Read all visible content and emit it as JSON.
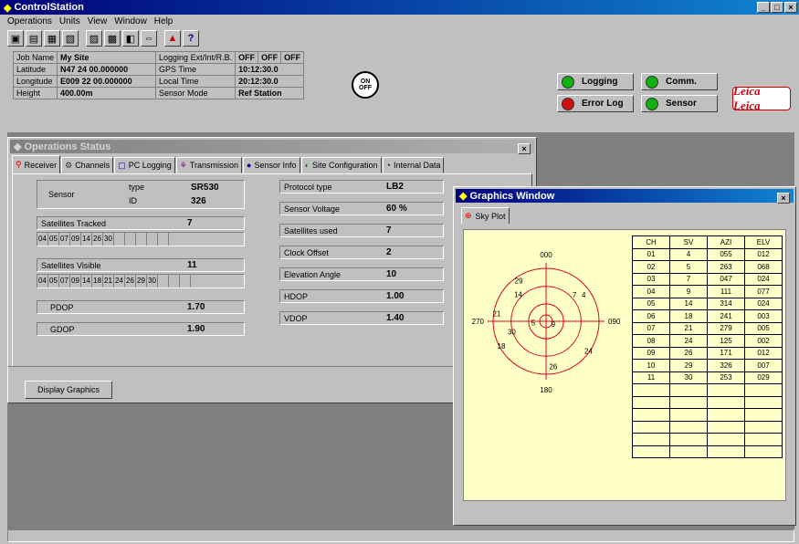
{
  "app_title": "ControlStation",
  "menu": [
    "Operations",
    "Units",
    "View",
    "Window",
    "Help"
  ],
  "toolbar_icons": [
    "tool1-icon",
    "tool2-icon",
    "tool3-icon",
    "tool4-icon",
    "tool5-icon",
    "tool6-icon",
    "tool7-icon",
    "tool8-icon",
    "tool9-icon",
    "help-icon"
  ],
  "info": {
    "job_name_label": "Job Name",
    "job_name": "My Site",
    "latitude_label": "Latitude",
    "latitude": "N47 24 00.000000",
    "longitude_label": "Longitude",
    "longitude": "E009 22 00.000000",
    "height_label": "Height",
    "height": "400.00m",
    "logging_label": "Logging Ext/Int/R.B.",
    "logging_vals": [
      "OFF",
      "OFF",
      "OFF"
    ],
    "gps_time_label": "GPS Time",
    "gps_time": "10:12:30.0",
    "local_time_label": "Local Time",
    "local_time": "20:12:30.0",
    "sensor_mode_label": "Sensor Mode",
    "sensor_mode": "Ref Station",
    "onoff": "ON OFF"
  },
  "status_buttons": [
    {
      "label": "Logging",
      "color": "#10b010"
    },
    {
      "label": "Comm.",
      "color": "#10b010"
    },
    {
      "label": "Error Log",
      "color": "#d01010"
    },
    {
      "label": "Sensor",
      "color": "#10b010"
    }
  ],
  "logo": "Leica Leica",
  "ops": {
    "title": "Operations Status",
    "tabs": [
      "Receiver",
      "Channels",
      "PC Logging",
      "Transmission",
      "Sensor Info",
      "Site Configuration",
      "Internal Data"
    ],
    "sensor_label": "Sensor",
    "type_label": "type",
    "type_val": "SR530",
    "id_label": "ID",
    "id_val": "326",
    "tracked_label": "Satellites Tracked",
    "tracked_count": "7",
    "tracked_list": [
      "04",
      "05",
      "07",
      "09",
      "14",
      "26",
      "30",
      "",
      "",
      "",
      "",
      ""
    ],
    "visible_label": "Satellites Visible",
    "visible_count": "11",
    "visible_list": [
      "04",
      "05",
      "07",
      "09",
      "14",
      "18",
      "21",
      "24",
      "26",
      "29",
      "30",
      "",
      "",
      ""
    ],
    "pdop_label": "PDOP",
    "pdop": "1.70",
    "gdop_label": "GDOP",
    "gdop": "1.90",
    "protocol_label": "Protocol type",
    "protocol": "LB2",
    "voltage_label": "Sensor Voltage",
    "voltage": "60 %",
    "sat_used_label": "Satellites used",
    "sat_used": "7",
    "clock_label": "Clock Offset",
    "clock": "2",
    "elev_label": "Elevation Angle",
    "elev": "10",
    "hdop_label": "HDOP",
    "hdop": "1.00",
    "vdop_label": "VDOP",
    "vdop": "1.40",
    "display_btn": "Display Graphics"
  },
  "graphics": {
    "title": "Graphics Window",
    "tab": "Sky Plot",
    "compass": [
      "000",
      "090",
      "180",
      "270"
    ],
    "sats": [
      {
        "n": "4",
        "az": 55,
        "el": 12
      },
      {
        "n": "5",
        "az": 263,
        "el": 68
      },
      {
        "n": "7",
        "az": 47,
        "el": 24
      },
      {
        "n": "9",
        "az": 111,
        "el": 77
      },
      {
        "n": "14",
        "az": 314,
        "el": 24
      },
      {
        "n": "18",
        "az": 241,
        "el": 3
      },
      {
        "n": "21",
        "az": 279,
        "el": 5
      },
      {
        "n": "24",
        "az": 125,
        "el": 2
      },
      {
        "n": "26",
        "az": 171,
        "el": 12
      },
      {
        "n": "29",
        "az": 326,
        "el": 7
      },
      {
        "n": "30",
        "az": 253,
        "el": 29
      }
    ],
    "headers": [
      "CH",
      "SV",
      "AZI",
      "ELV"
    ],
    "rows": [
      [
        "01",
        "4",
        "055",
        "012"
      ],
      [
        "02",
        "5",
        "263",
        "068"
      ],
      [
        "03",
        "7",
        "047",
        "024"
      ],
      [
        "04",
        "9",
        "111",
        "077"
      ],
      [
        "05",
        "14",
        "314",
        "024"
      ],
      [
        "06",
        "18",
        "241",
        "003"
      ],
      [
        "07",
        "21",
        "279",
        "005"
      ],
      [
        "08",
        "24",
        "125",
        "002"
      ],
      [
        "09",
        "26",
        "171",
        "012"
      ],
      [
        "10",
        "29",
        "326",
        "007"
      ],
      [
        "11",
        "30",
        "253",
        "029"
      ],
      [
        "",
        "",
        "",
        ""
      ],
      [
        "",
        "",
        "",
        ""
      ],
      [
        "",
        "",
        "",
        ""
      ],
      [
        "",
        "",
        "",
        ""
      ],
      [
        "",
        "",
        "",
        ""
      ],
      [
        "",
        "",
        "",
        ""
      ]
    ]
  }
}
